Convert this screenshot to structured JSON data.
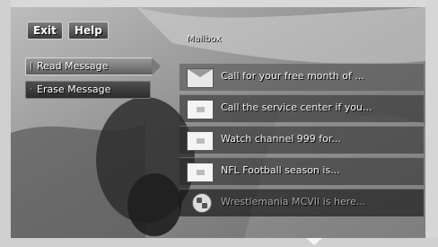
{
  "top_buttons": {
    "exit": "Exit",
    "help": "Help"
  },
  "menu": {
    "read_message": "Read Message",
    "erase_message": "Erase Message"
  },
  "mailbox": {
    "title": "Mailbox",
    "messages": [
      {
        "text": "Call for your free month of ...",
        "icon": "open-envelope-icon",
        "read": true
      },
      {
        "text": "Call the service center if you...",
        "icon": "envelope-icon",
        "read": false
      },
      {
        "text": "Watch channel 999 for...",
        "icon": "envelope-icon",
        "read": false
      },
      {
        "text": "NFL Football season is...",
        "icon": "envelope-icon",
        "read": false
      },
      {
        "text": "Wrestlemania MCVII is here...",
        "icon": "soccer-ball-icon",
        "read": false
      }
    ]
  }
}
